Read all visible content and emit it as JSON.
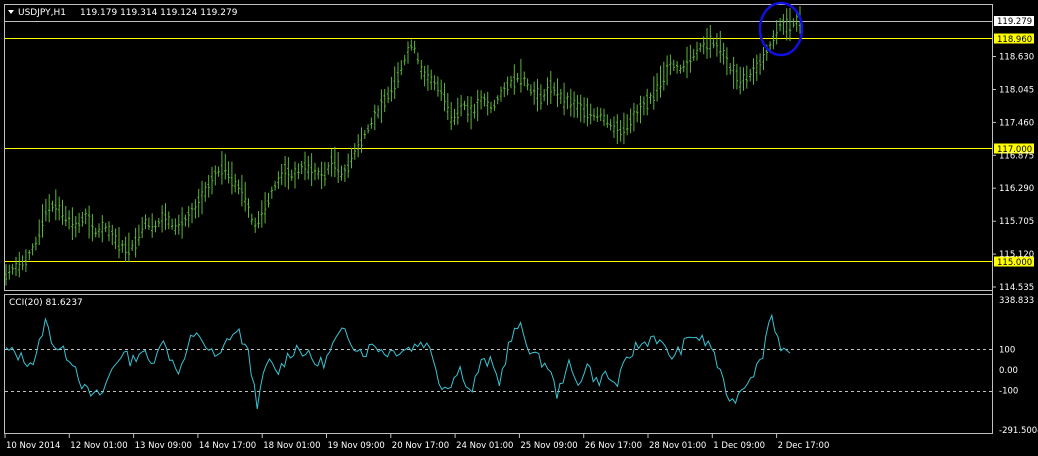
{
  "header": {
    "symbol": "USDJPY,H1",
    "ohlc": "119.179 119.314 119.124 119.279"
  },
  "indicator": {
    "label": "CCI(20) 81.6237"
  },
  "colors": {
    "background": "#000000",
    "candle": "#5fb53a",
    "cci_line": "#38c3d3",
    "horizontal_line": "#ffff00",
    "marker_circle": "#0000ff",
    "price_tag": "#ffff00"
  },
  "chart_data": [
    {
      "type": "line",
      "title": "USDJPY,H1",
      "ylim": [
        114.5,
        119.5
      ],
      "y_ticks": [
        "119.279",
        "118.630",
        "118.045",
        "117.460",
        "116.875",
        "116.290",
        "115.705",
        "115.120",
        "114.535"
      ],
      "x_tick_labels": [
        "10 Nov 2014",
        "12 Nov 01:00",
        "13 Nov 09:00",
        "14 Nov 17:00",
        "18 Nov 01:00",
        "19 Nov 09:00",
        "20 Nov 17:00",
        "24 Nov 01:00",
        "25 Nov 09:00",
        "26 Nov 17:00",
        "28 Nov 01:00",
        "1 Dec 09:00",
        "2 Dec 17:00"
      ],
      "horizontal_lines": [
        {
          "value": 118.96,
          "label": "118.960"
        },
        {
          "value": 117.0,
          "label": "117.000"
        },
        {
          "value": 115.0,
          "label": "115.000"
        }
      ],
      "series": [
        {
          "values": [
            114.75,
            114.9,
            115.0,
            115.3,
            115.9,
            116.0,
            115.8,
            115.6,
            115.8,
            115.5,
            115.6,
            115.4,
            115.2,
            115.3,
            115.7,
            115.6,
            115.8,
            115.6,
            115.7,
            115.9,
            116.2,
            116.5,
            116.7,
            116.4,
            116.2,
            115.6,
            115.9,
            116.3,
            116.6,
            116.5,
            116.7,
            116.6,
            116.5,
            116.8,
            116.5,
            116.9,
            117.2,
            117.5,
            117.8,
            118.1,
            118.5,
            118.9,
            118.3,
            118.2,
            118.0,
            117.5,
            117.8,
            117.6,
            117.9,
            117.7,
            118.0,
            118.2,
            118.3,
            118.0,
            117.9,
            118.1,
            117.9,
            117.8,
            117.7,
            117.6,
            117.6,
            117.4,
            117.3,
            117.5,
            117.7,
            117.9,
            118.2,
            118.5,
            118.4,
            118.6,
            118.8,
            118.9,
            118.8,
            118.4,
            118.2,
            118.3,
            118.5,
            118.8,
            119.2,
            119.2,
            119.28
          ]
        }
      ]
    },
    {
      "type": "line",
      "title": "CCI(20) 81.6237",
      "ylim": [
        -291.5,
        338.833
      ],
      "y_ticks": [
        "338.833",
        "100",
        "0.00",
        "-100",
        "-291.5004"
      ],
      "horizontal_lines": [
        {
          "value": 100
        },
        {
          "value": -100
        }
      ],
      "series": [
        {
          "values": [
            95,
            80,
            45,
            35,
            240,
            120,
            85,
            40,
            -90,
            -130,
            -110,
            10,
            85,
            40,
            100,
            20,
            150,
            60,
            -10,
            140,
            170,
            90,
            50,
            160,
            190,
            80,
            -170,
            50,
            -20,
            60,
            110,
            80,
            30,
            40,
            140,
            190,
            120,
            80,
            130,
            85,
            90,
            100,
            110,
            140,
            90,
            -90,
            -60,
            10,
            -120,
            30,
            40,
            -60,
            130,
            220,
            110,
            50,
            20,
            -130,
            40,
            -80,
            30,
            -60,
            -20,
            -80,
            30,
            110,
            130,
            170,
            100,
            60,
            120,
            170,
            140,
            110,
            -60,
            -160,
            -90,
            -20,
            40,
            280,
            120,
            81.6
          ]
        }
      ]
    }
  ]
}
